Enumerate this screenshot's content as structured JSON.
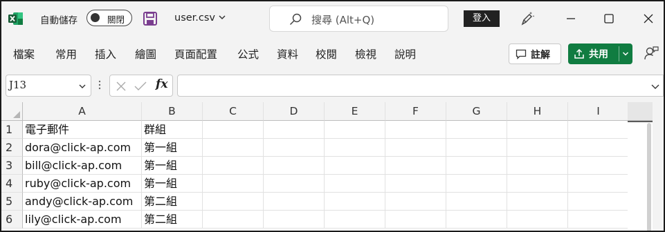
{
  "titlebar": {
    "autosave_label": "自動儲存",
    "autosave_state": "關閉",
    "filename": "user.csv",
    "search_placeholder": "搜尋 (Alt+Q)",
    "signin_label": "登入"
  },
  "menu": {
    "items": [
      "檔案",
      "常用",
      "插入",
      "繪圖",
      "頁面配置",
      "公式",
      "資料",
      "校閱",
      "檢視",
      "說明"
    ],
    "comment_label": "註解",
    "share_label": "共用"
  },
  "formula_bar": {
    "name_box": "J13",
    "fx_label": "fx",
    "formula": ""
  },
  "sheet": {
    "columns": [
      "A",
      "B",
      "C",
      "D",
      "E",
      "F",
      "G",
      "H",
      "I"
    ],
    "rows": [
      {
        "num": "1",
        "a": "電子郵件",
        "b": "群組"
      },
      {
        "num": "2",
        "a": "dora@click-ap.com",
        "b": "第一組"
      },
      {
        "num": "3",
        "a": "bill@click-ap.com",
        "b": "第一組"
      },
      {
        "num": "4",
        "a": "ruby@click-ap.com",
        "b": "第一組"
      },
      {
        "num": "5",
        "a": "andy@click-ap.com",
        "b": "第二組"
      },
      {
        "num": "6",
        "a": "lily@click-ap.com",
        "b": "第二組"
      }
    ]
  },
  "colors": {
    "excel_green": "#107c41",
    "save_purple": "#7a3d8f",
    "background": "#f3f3f3"
  }
}
